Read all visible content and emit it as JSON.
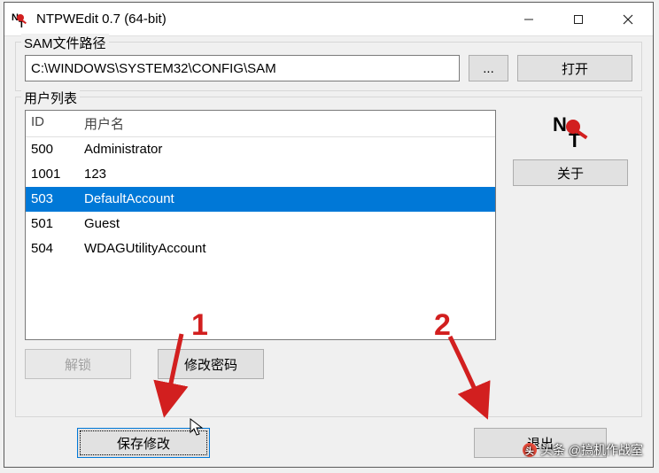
{
  "window": {
    "title": "NTPWEdit 0.7 (64-bit)"
  },
  "sam": {
    "legend": "SAM文件路径",
    "path_value": "C:\\WINDOWS\\SYSTEM32\\CONFIG\\SAM",
    "browse_label": "...",
    "open_label": "打开"
  },
  "users": {
    "legend": "用户列表",
    "col_id": "ID",
    "col_name": "用户名",
    "rows": [
      {
        "id": "500",
        "name": "Administrator",
        "selected": false
      },
      {
        "id": "1001",
        "name": "123",
        "selected": false
      },
      {
        "id": "503",
        "name": "DefaultAccount",
        "selected": true
      },
      {
        "id": "501",
        "name": "Guest",
        "selected": false
      },
      {
        "id": "504",
        "name": "WDAGUtilityAccount",
        "selected": false
      }
    ],
    "unlock_label": "解锁",
    "change_pw_label": "修改密码",
    "about_label": "关于"
  },
  "bottom": {
    "save_label": "保存修改",
    "exit_label": "退出"
  },
  "annotations": {
    "one": "1",
    "two": "2"
  },
  "watermark": {
    "text": "头条 @搞机作战室"
  }
}
